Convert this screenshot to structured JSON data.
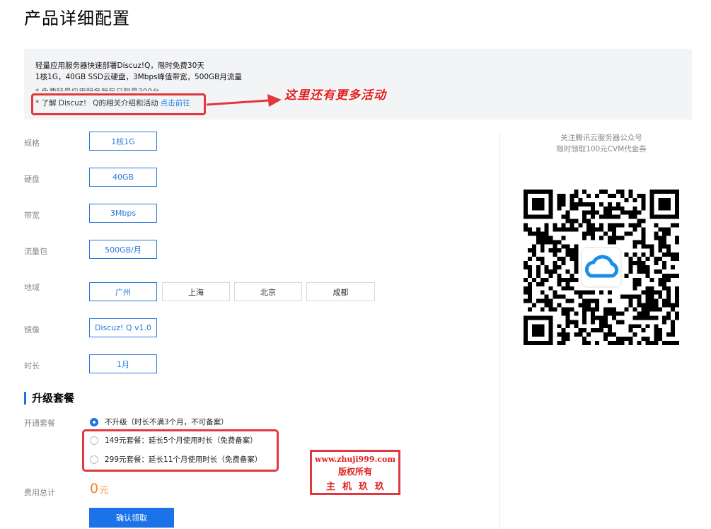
{
  "page": {
    "title": "产品详细配置"
  },
  "notice": {
    "line1": "轻量应用服务器快速部署Discuz!Q，限时免费30天",
    "line2": "1核1G，40GB SSD云硬盘，3Mbps峰值带宽，500GB月流量",
    "line3": "* 免费轻量应用服务器每日限量300台",
    "line4_prefix": "* 了解 Discuz！ Q的相关介绍和活动 ",
    "line4_link": "点击前往"
  },
  "annotation": {
    "callout": "这里还有更多活动"
  },
  "config": {
    "spec": {
      "label": "规格",
      "value": "1核1G"
    },
    "disk": {
      "label": "硬盘",
      "value": "40GB"
    },
    "bandwidth": {
      "label": "带宽",
      "value": "3Mbps"
    },
    "traffic": {
      "label": "流量包",
      "value": "500GB/月"
    },
    "region": {
      "label": "地域",
      "options": [
        "广州",
        "上海",
        "北京",
        "成都"
      ],
      "selected": "广州"
    },
    "image": {
      "label": "镜像",
      "value": "Discuz! Q v1.0"
    },
    "duration": {
      "label": "时长",
      "value": "1月"
    }
  },
  "upgrade": {
    "title": "升级套餐",
    "label": "开通套餐",
    "options": [
      {
        "text": "不升级（时长不满3个月，不可备案）",
        "selected": true
      },
      {
        "text": "149元套餐：延长5个月使用时长（免费备案）",
        "selected": false
      },
      {
        "text": "299元套餐：延长11个月使用时长（免费备案）",
        "selected": false
      }
    ]
  },
  "total": {
    "label": "费用总计",
    "amount": "0",
    "unit": "元"
  },
  "confirm_label": "确认领取",
  "watermark": {
    "url": "www.zhuji999.com",
    "rights": "版权所有",
    "name": "主机玖玖"
  },
  "sidebar": {
    "line1": "关注腾讯云服务器公众号",
    "line2": "限时领取100元CVM代金券"
  },
  "colors": {
    "accent": "#1a74e8",
    "annotation_red": "#e0383e",
    "total_orange": "#f58220"
  }
}
